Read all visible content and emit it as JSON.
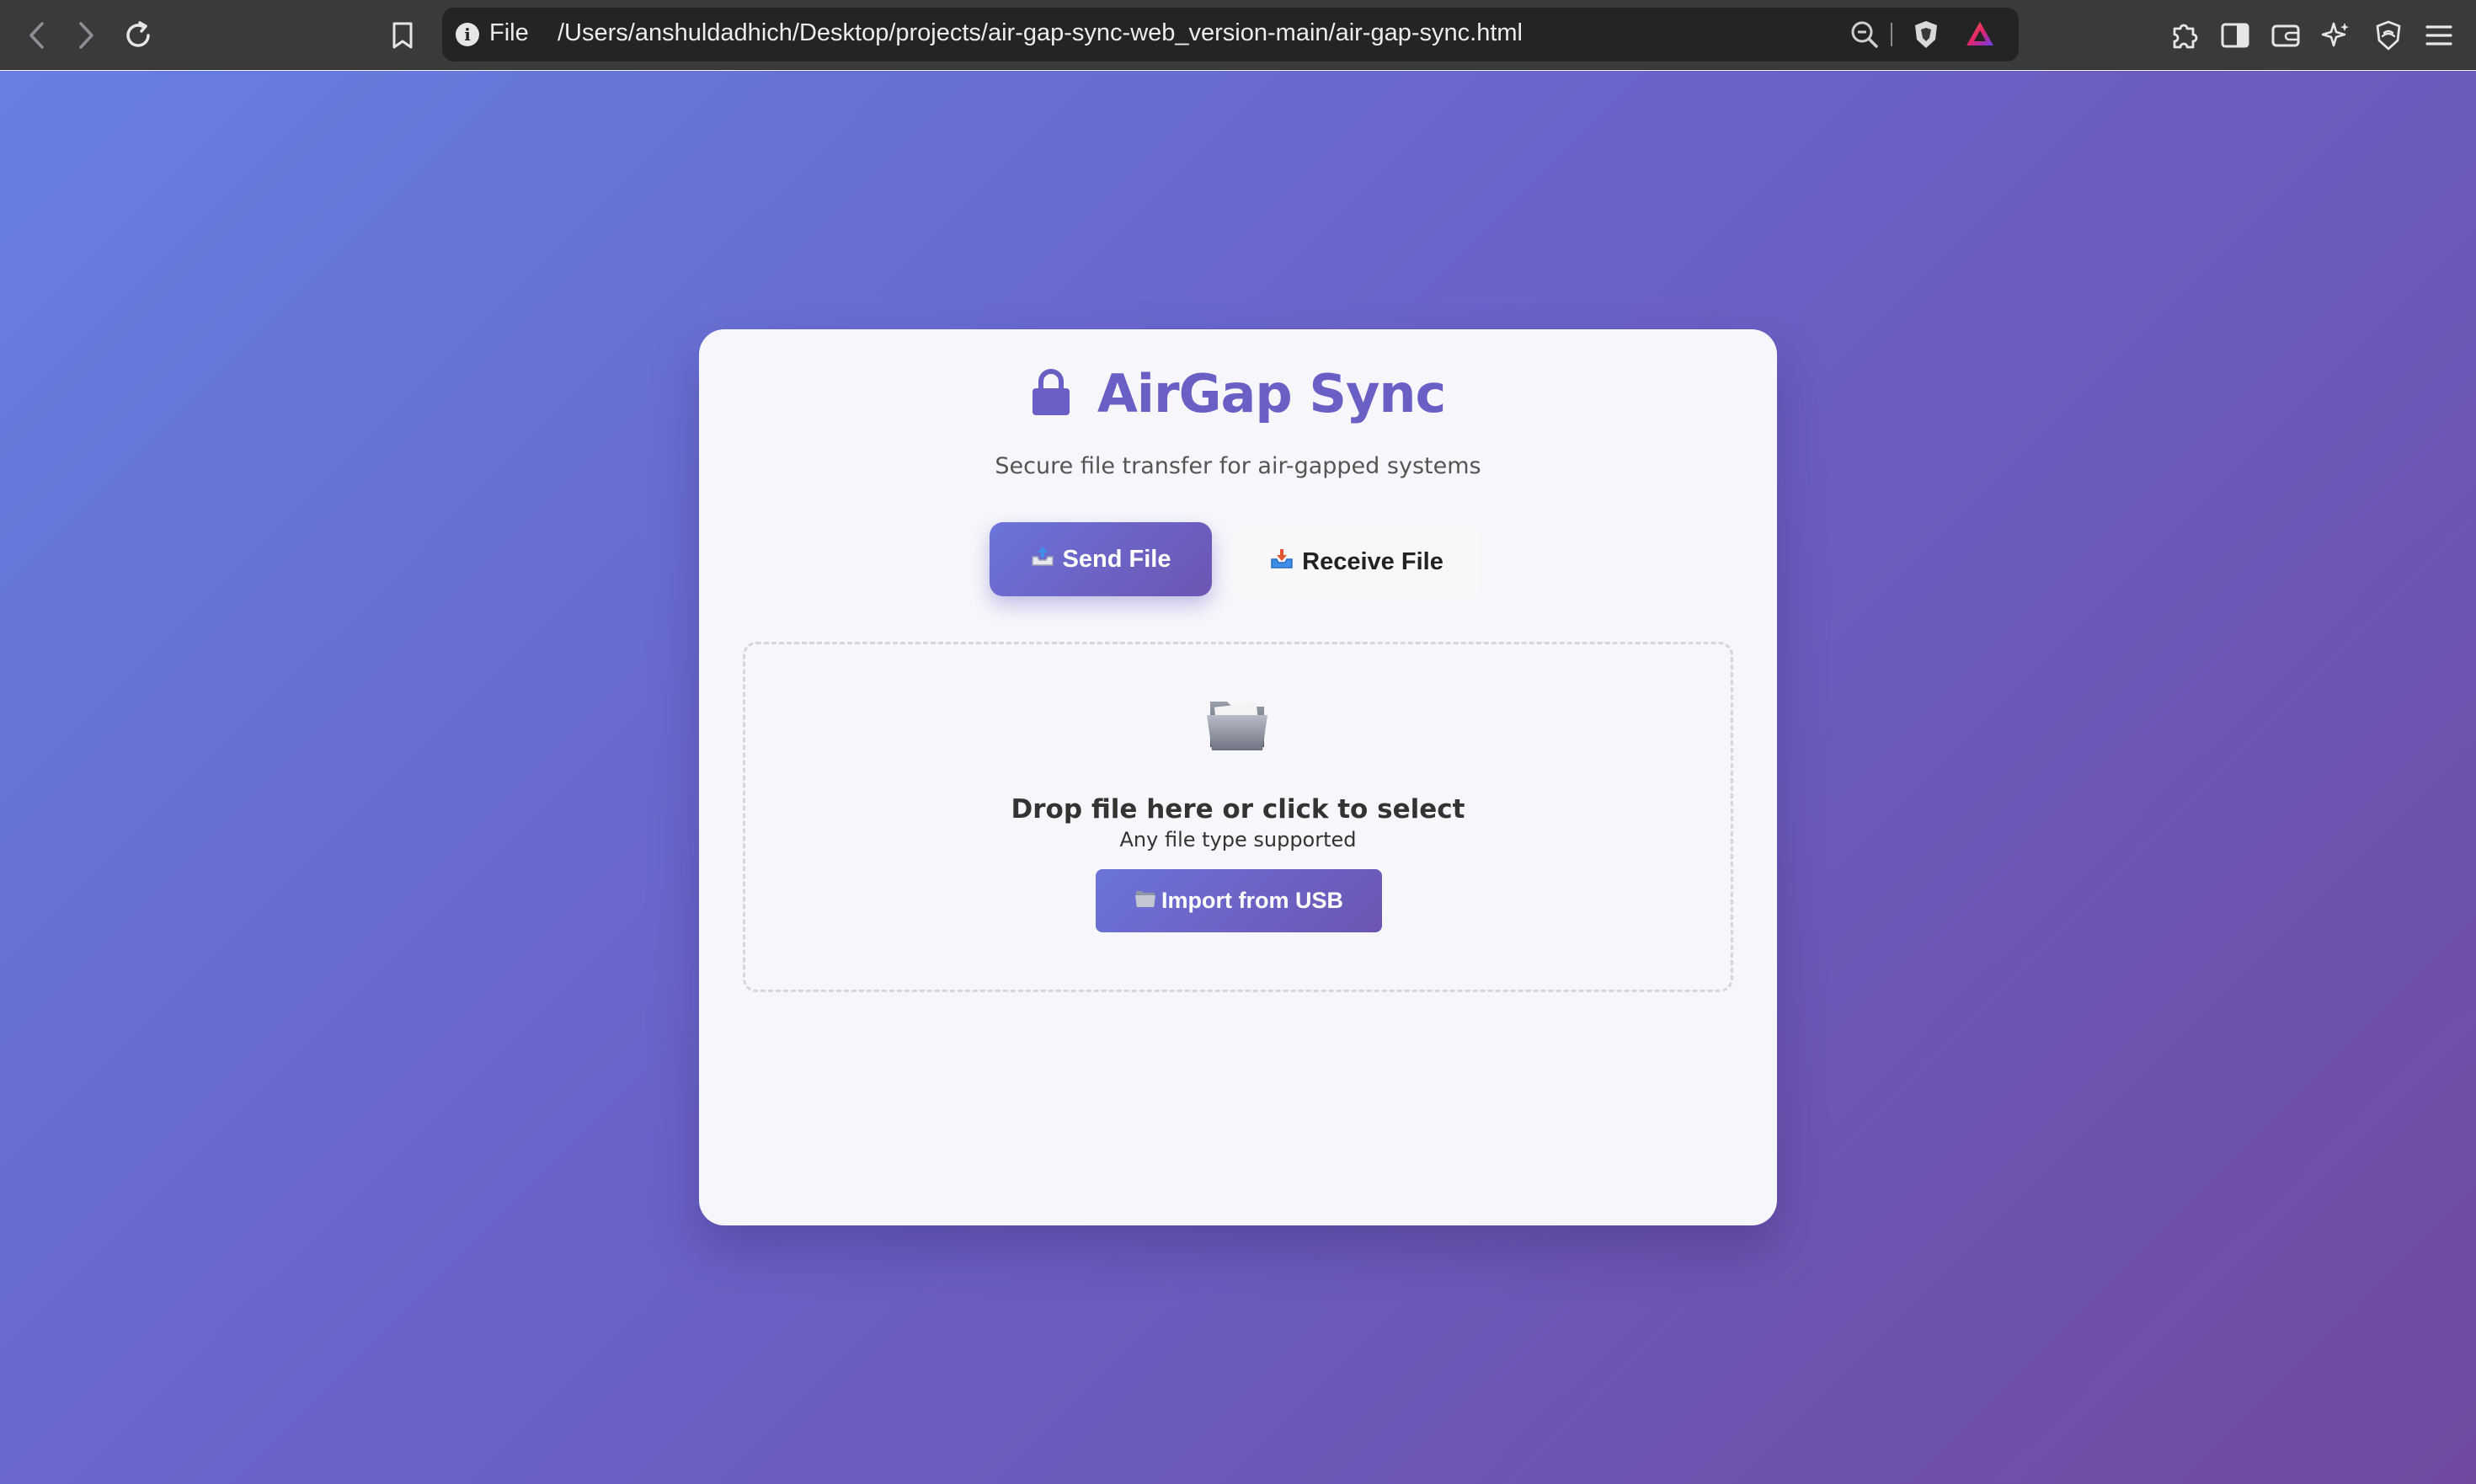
{
  "browser": {
    "url_scheme_label": "File",
    "url": "/Users/anshuldadhich/Desktop/projects/air-gap-sync-web_version-main/air-gap-sync.html",
    "toolbar_icons": [
      "back-icon",
      "forward-icon",
      "reload-icon",
      "bookmark-icon",
      "site-info-icon",
      "zoom-icon",
      "brave-shields-icon",
      "brave-rewards-icon",
      "extensions-icon",
      "sidebar-icon",
      "wallet-icon",
      "leo-ai-icon",
      "vpn-icon",
      "menu-icon"
    ]
  },
  "app": {
    "title": "AirGap Sync",
    "subtitle": "Secure file transfer for air-gapped systems",
    "accent_color": "#6a5fc4",
    "tabs": [
      {
        "label": "Send File",
        "icon": "outbox-tray-icon",
        "active": true
      },
      {
        "label": "Receive File",
        "icon": "inbox-tray-icon",
        "active": false
      }
    ],
    "dropzone": {
      "icon": "folder-icon",
      "title": "Drop file here or click to select",
      "subtitle": "Any file type supported",
      "import_button": "Import from USB",
      "import_icon": "folder-icon"
    }
  }
}
